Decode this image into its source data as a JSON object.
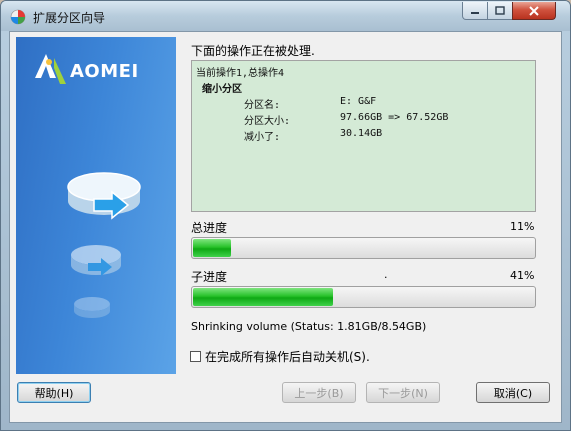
{
  "window": {
    "title": "扩展分区向导",
    "accent_color": "#3d86d8"
  },
  "sidebar": {
    "logo_text": "AOMEI"
  },
  "operation": {
    "heading": "下面的操作正在被处理.",
    "log": {
      "line1": "当前操作1,总操作4",
      "line2": "缩小分区",
      "rows": [
        {
          "label": "分区名:",
          "value": "E: G&F"
        },
        {
          "label": "分区大小:",
          "value": "97.66GB => 67.52GB"
        },
        {
          "label": "减小了:",
          "value": "30.14GB"
        }
      ]
    }
  },
  "progress": {
    "total_label": "总进度",
    "total_percent_text": "11%",
    "total_value": 0.11,
    "sub_label": "子进度",
    "sub_marker": ".",
    "sub_percent_text": "41%",
    "sub_value": 0.41,
    "status_text": "Shrinking volume (Status: 1.81GB/8.54GB)"
  },
  "options": {
    "auto_shutdown_label": "在完成所有操作后自动关机(S).",
    "auto_shutdown_checked": false
  },
  "buttons": {
    "help": "帮助(H)",
    "back": "上一步(B)",
    "next": "下一步(N)",
    "cancel": "取消(C)"
  },
  "colors": {
    "log_background": "#d4ead6",
    "progress_green": "#1fb823"
  }
}
